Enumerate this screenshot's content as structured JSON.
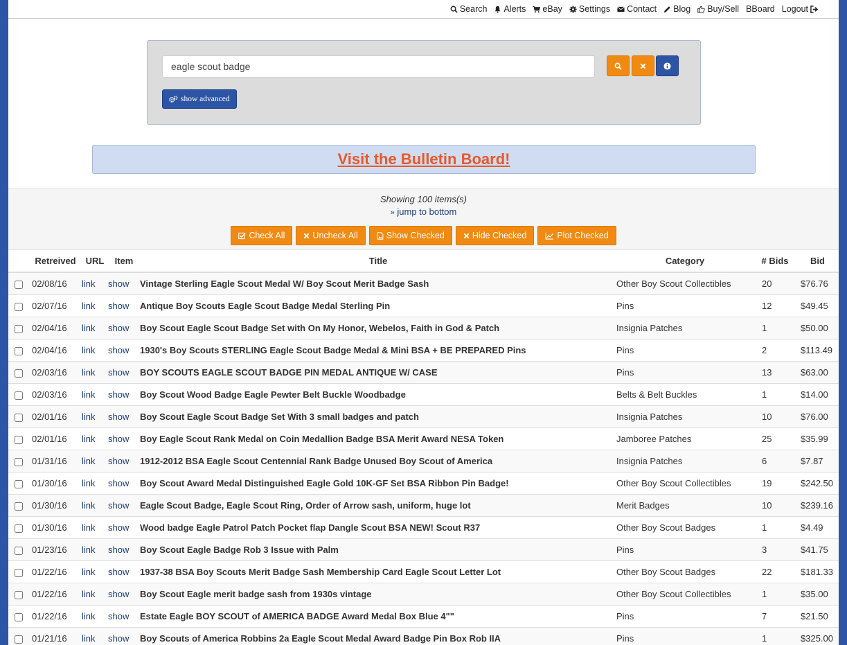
{
  "nav": {
    "search": "Search",
    "alerts": "Alerts",
    "ebay": "eBay",
    "settings": "Settings",
    "contact": "Contact",
    "blog": "Blog",
    "buysell": "Buy/Sell",
    "bboard": "BBoard",
    "logout": "Logout"
  },
  "search": {
    "value": "eagle scout badge",
    "advanced_label": "show advanced"
  },
  "bulletin": {
    "label": "Visit the Bulletin Board!"
  },
  "results": {
    "showing": "Showing 100 items(s)",
    "jump": "jump to bottom"
  },
  "actions": {
    "check_all": "Check All",
    "uncheck_all": "Uncheck All",
    "show_checked": "Show Checked",
    "hide_checked": "Hide Checked",
    "plot_checked": "Plot Checked"
  },
  "table": {
    "headers": [
      "Retreived",
      "URL",
      "Item",
      "Title",
      "Category",
      "# Bids",
      "Bid"
    ],
    "rows": [
      {
        "date": "02/08/16",
        "link": "link",
        "show": "show",
        "title": "Vintage Sterling Eagle Scout Medal W/ Boy Scout Merit Badge Sash",
        "category": "Other Boy Scout Collectibles",
        "bids": "20",
        "bid": "$76.76"
      },
      {
        "date": "02/07/16",
        "link": "link",
        "show": "show",
        "title": "Antique Boy Scouts Eagle Scout Badge Medal Sterling Pin",
        "category": "Pins",
        "bids": "12",
        "bid": "$49.45"
      },
      {
        "date": "02/04/16",
        "link": "link",
        "show": "show",
        "title": "Boy Scout Eagle Scout Badge Set with On My Honor, Webelos, Faith in God & Patch",
        "category": "Insignia Patches",
        "bids": "1",
        "bid": "$50.00"
      },
      {
        "date": "02/04/16",
        "link": "link",
        "show": "show",
        "title": "1930's Boy Scouts STERLING Eagle Scout Badge Medal & Mini BSA + BE PREPARED Pins",
        "category": "Pins",
        "bids": "2",
        "bid": "$113.49"
      },
      {
        "date": "02/03/16",
        "link": "link",
        "show": "show",
        "title": "BOY SCOUTS EAGLE SCOUT BADGE PIN MEDAL ANTIQUE W/ CASE",
        "category": "Pins",
        "bids": "13",
        "bid": "$63.00"
      },
      {
        "date": "02/03/16",
        "link": "link",
        "show": "show",
        "title": "Boy Scout Wood Badge Eagle Pewter Belt Buckle Woodbadge",
        "category": "Belts & Belt Buckles",
        "bids": "1",
        "bid": "$14.00"
      },
      {
        "date": "02/01/16",
        "link": "link",
        "show": "show",
        "title": "Boy Scout Eagle Scout Badge Set With 3 small badges and patch",
        "category": "Insignia Patches",
        "bids": "10",
        "bid": "$76.00"
      },
      {
        "date": "02/01/16",
        "link": "link",
        "show": "show",
        "title": "Boy Eagle Scout Rank Medal on Coin Medallion Badge BSA Merit Award NESA Token",
        "category": "Jamboree Patches",
        "bids": "25",
        "bid": "$35.99"
      },
      {
        "date": "01/31/16",
        "link": "link",
        "show": "show",
        "title": "1912-2012 BSA Eagle Scout Centennial Rank Badge Unused Boy Scout of America",
        "category": "Insignia Patches",
        "bids": "6",
        "bid": "$7.87"
      },
      {
        "date": "01/30/16",
        "link": "link",
        "show": "show",
        "title": "Boy Scout Award Medal Distinguished Eagle Gold 10K-GF Set BSA Ribbon Pin Badge!",
        "category": "Other Boy Scout Collectibles",
        "bids": "19",
        "bid": "$242.50"
      },
      {
        "date": "01/30/16",
        "link": "link",
        "show": "show",
        "title": "Eagle Scout Badge, Eagle Scout Ring, Order of Arrow sash, uniform, huge lot",
        "category": "Merit Badges",
        "bids": "10",
        "bid": "$239.16"
      },
      {
        "date": "01/30/16",
        "link": "link",
        "show": "show",
        "title": "Wood badge Eagle Patrol Patch Pocket flap Dangle Scout BSA NEW! Scout R37",
        "category": "Other Boy Scout Badges",
        "bids": "1",
        "bid": "$4.49"
      },
      {
        "date": "01/23/16",
        "link": "link",
        "show": "show",
        "title": "Boy Scout Eagle Badge Rob 3 Issue with Palm",
        "category": "Pins",
        "bids": "3",
        "bid": "$41.75"
      },
      {
        "date": "01/22/16",
        "link": "link",
        "show": "show",
        "title": "1937-38 BSA Boy Scouts Merit Badge Sash Membership Card Eagle Scout Letter Lot",
        "category": "Other Boy Scout Badges",
        "bids": "22",
        "bid": "$181.33"
      },
      {
        "date": "01/22/16",
        "link": "link",
        "show": "show",
        "title": "Boy Scout Eagle merit badge sash from 1930s vintage",
        "category": "Other Boy Scout Collectibles",
        "bids": "1",
        "bid": "$35.00"
      },
      {
        "date": "01/22/16",
        "link": "link",
        "show": "show",
        "title": "Estate Eagle BOY SCOUT of AMERICA BADGE Award Medal Box Blue 4\"\"",
        "category": "Pins",
        "bids": "7",
        "bid": "$21.50"
      },
      {
        "date": "01/21/16",
        "link": "link",
        "show": "show",
        "title": "Boy Scouts of America Robbins 2a Eagle Scout Medal Award Badge Pin Box Rob IIA",
        "category": "Pins",
        "bids": "1",
        "bid": "$325.00"
      }
    ]
  },
  "colors": {
    "frame": "#2c55a6",
    "accent_orange": "#f08a13",
    "bulletin_text": "#e8592a",
    "bulletin_bg": "#cfdcf2"
  }
}
